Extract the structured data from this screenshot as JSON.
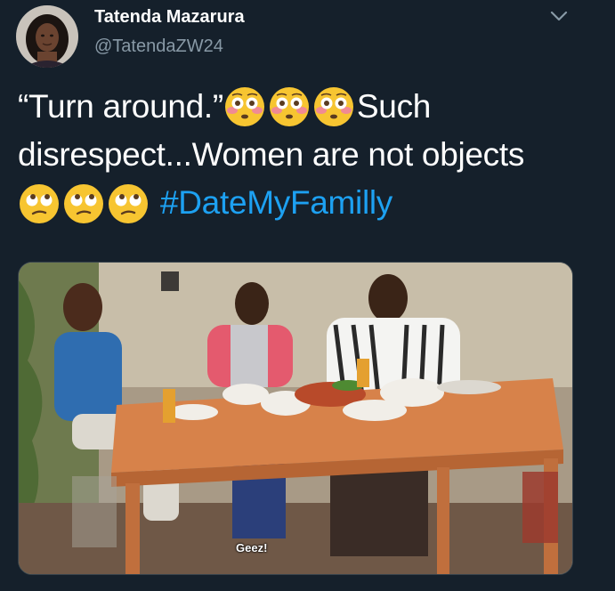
{
  "author": {
    "display_name": "Tatenda Mazarura",
    "handle": "@TatendaZW24"
  },
  "menu": {
    "icon": "chevron-down-icon"
  },
  "tweet": {
    "text_part1": "“Turn around.”",
    "text_part2": "Such disrespect...Women are not objects",
    "hashtag": "#DateMyFamilly",
    "emoji_flushed": "flushed-face-emoji",
    "emoji_eye_roll": "face-with-rolling-eyes-emoji"
  },
  "media": {
    "description_icon": "video-still-image",
    "watermark": "Geez!"
  },
  "colors": {
    "background": "#15202b",
    "text": "#ffffff",
    "secondary_text": "#8899a6",
    "link": "#1da1f2"
  }
}
